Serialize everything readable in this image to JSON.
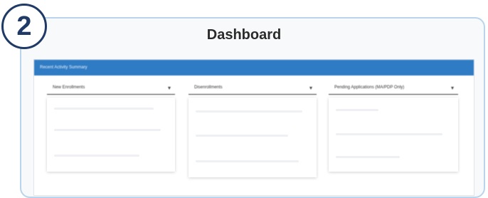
{
  "step": {
    "number": "2"
  },
  "page": {
    "title": "Dashboard"
  },
  "card": {
    "header": "Recent Activity Summary",
    "columns": [
      {
        "dropdown_label": "New Enrollments"
      },
      {
        "dropdown_label": "Disenrollments"
      },
      {
        "dropdown_label": "Pending Applications (MA/PDP Only)"
      }
    ]
  },
  "colors": {
    "accent": "#2f7bc4",
    "badge": "#1f3a66",
    "frame": "#b9d4ec"
  }
}
